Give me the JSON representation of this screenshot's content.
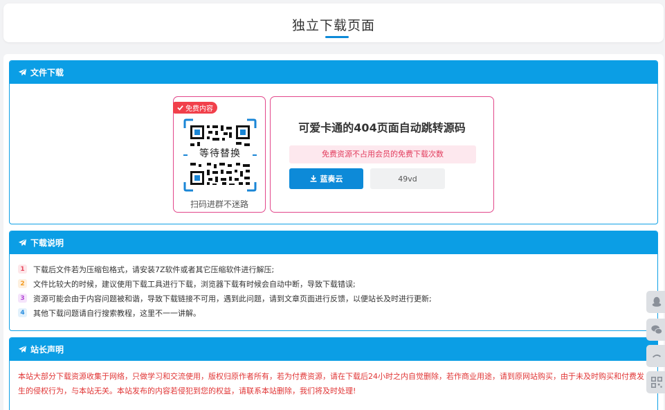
{
  "header": {
    "title": "独立下载页面"
  },
  "file_panel": {
    "title": "文件下载",
    "badge": "免费内容",
    "qr_overlay": "等待替换",
    "qr_caption": "扫码进群不迷路",
    "download_title": "可爱卡通的404页面自动跳转源码",
    "notice": "免费资源不占用会员的免费下载次数",
    "lanzou_label": "蓝奏云",
    "code_label": "49vd"
  },
  "instructions": {
    "title": "下载说明",
    "items": [
      {
        "num": "1",
        "text": "下载后文件若为压缩包格式，请安装7Z软件或者其它压缩软件进行解压;"
      },
      {
        "num": "2",
        "text": "文件比较大的时候，建议使用下载工具进行下载，浏览器下载有时候会自动中断，导致下载错误;"
      },
      {
        "num": "3",
        "text": "资源可能会由于内容问题被和谐，导致下载链接不可用，遇到此问题，请到文章页面进行反馈，以便站长及时进行更新;"
      },
      {
        "num": "4",
        "text": "其他下载问题请自行搜索教程，这里不一一讲解。"
      }
    ],
    "colors": {
      "num1": {
        "bg": "#fde7ea",
        "fg": "#e8485d"
      },
      "num2": {
        "bg": "#fef0df",
        "fg": "#f39a1e"
      },
      "num3": {
        "bg": "#f5e4fb",
        "fg": "#b54bd6"
      },
      "num4": {
        "bg": "#e2f1fc",
        "fg": "#2a8fe0"
      }
    }
  },
  "statement": {
    "title": "站长声明",
    "text": "本站大部分下载资源收集于网络，只做学习和交流使用，版权归原作者所有，若为付费资源，请在下载后24小时之内自觉删除，若作商业用途，请到原网站购买，由于未及时购买和付费发生的侵权行为，与本站无关。本站发布的内容若侵犯到您的权益，请联系本站删除，我们将及时处理!"
  },
  "sidebar": {
    "icons": [
      "qq-icon",
      "wechat-icon",
      "weibo-icon",
      "qrcode-icon"
    ]
  },
  "colors": {
    "accent": "#0b9ee5",
    "pink_border": "#e2468a",
    "red_text": "#e03535"
  }
}
